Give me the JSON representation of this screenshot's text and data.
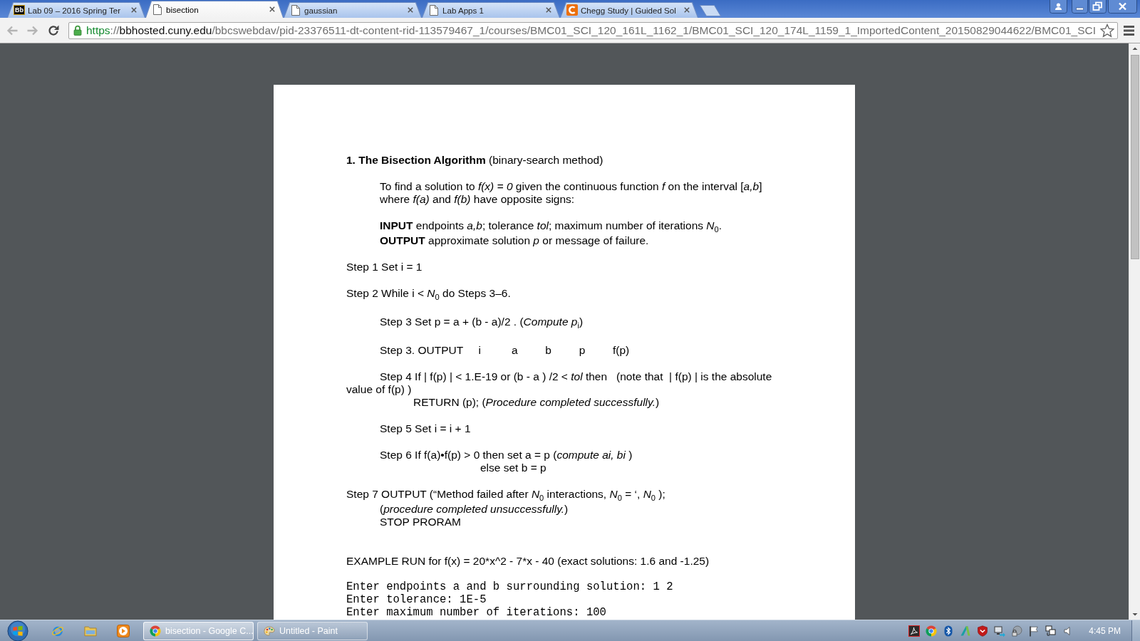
{
  "browser": {
    "tabs": [
      {
        "kind": "badge",
        "title": "Lab 09 – 2016 Spring Ter",
        "favicon_text": "Bb",
        "selected": false
      },
      {
        "kind": "page",
        "title": "bisection",
        "selected": true
      },
      {
        "kind": "page",
        "title": "gaussian",
        "selected": false
      },
      {
        "kind": "page",
        "title": "Lab Apps 1",
        "selected": false
      },
      {
        "kind": "letter-c",
        "title": "Chegg Study | Guided Sol",
        "selected": false
      }
    ],
    "nav": [
      {
        "kind": "back",
        "disabled": true
      },
      {
        "kind": "forward",
        "disabled": true
      },
      {
        "kind": "reload",
        "disabled": false
      }
    ],
    "address": [
      {
        "kind": "scheme",
        "text": "https"
      },
      {
        "kind": "separator",
        "text": "://"
      },
      {
        "kind": "host",
        "text": "bbhosted.cuny.edu"
      },
      {
        "kind": "path",
        "text": "/bbcswebdav/pid-23376511-dt-content-rid-113579467_1/courses/BMC01_SCI_120_161L_1162_1/BMC01_SCI_120_174L_1159_1_ImportedContent_20150829044622/BMC01_SCI"
      }
    ]
  },
  "document": {
    "blocks": [
      {
        "kind": "heading",
        "lines": [
          {
            "kind": "flush",
            "text": "**1. The Bisection Algorithm** (binary-search method)"
          }
        ]
      },
      {
        "kind": "text",
        "lines": [
          {
            "kind": "indent",
            "text": "To find a solution to *f(x) = 0* given the continuous function *f* on the interval [*a,b*]"
          },
          {
            "kind": "indent",
            "text": "where *f(a)* and *f(b)* have opposite signs:"
          }
        ]
      },
      {
        "kind": "text",
        "lines": [
          {
            "kind": "indent",
            "text": "**INPUT** endpoints *a,b*; tolerance *tol*; maximum number of iterations *N*$_{0}$."
          },
          {
            "kind": "indent",
            "text": "**OUTPUT** approximate solution *p* or message of failure."
          }
        ]
      },
      {
        "kind": "step",
        "lines": [
          {
            "kind": "flush",
            "text": "Step 1 Set i = 1"
          }
        ]
      },
      {
        "kind": "step",
        "lines": [
          {
            "kind": "flush",
            "text": "Step 2 While i < *N*$_{0}$ do Steps 3–6."
          }
        ]
      },
      {
        "kind": "step",
        "lines": [
          {
            "kind": "indent",
            "text": "Step 3 Set p = a + (b - a)/2 . (*Compute p*$_{i}$)"
          }
        ]
      },
      {
        "kind": "step",
        "lines": [
          {
            "kind": "indent",
            "text": "Step 3. OUTPUT     i          a         b         p         f(p)"
          }
        ]
      },
      {
        "kind": "step",
        "lines": [
          {
            "kind": "indent",
            "text": "Step 4 If | f(p) | < 1.E-19 or (b - a ) /2 < *tol* then   (note that  | f(p) | is the absolute"
          },
          {
            "kind": "flush",
            "text": "value of f(p) )"
          },
          {
            "kind": "deep",
            "text": "RETURN (p); (*Procedure completed successfully.*)"
          }
        ]
      },
      {
        "kind": "step",
        "lines": [
          {
            "kind": "indent",
            "text": "Step 5 Set i = i + 1"
          }
        ]
      },
      {
        "kind": "step",
        "lines": [
          {
            "kind": "indent",
            "text": "Step 6 If f(a)•f(p) > 0 then set a = p (*compute ai, bi* )"
          },
          {
            "kind": "far",
            "text": "else set b = p"
          }
        ]
      },
      {
        "kind": "step",
        "lines": [
          {
            "kind": "flush",
            "text": "Step 7 OUTPUT (“Method failed after *N*$_{0}$ interactions, *N*$_{0}$ = ‘, *N*$_{0}$ );"
          },
          {
            "kind": "indent",
            "text": "(*procedure completed unsuccessfully.*)"
          },
          {
            "kind": "indent",
            "text": "STOP PRORAM"
          }
        ]
      },
      {
        "kind": "plain",
        "lines": [
          {
            "kind": "flush",
            "text": "EXAMPLE RUN for f(x) = 20*x^2 - 7*x - 40 (exact solutions: 1.6 and -1.25)"
          }
        ]
      },
      {
        "kind": "code",
        "lines": [
          {
            "kind": "flush",
            "text": "Enter endpoints a and b surrounding solution: 1 2"
          },
          {
            "kind": "flush",
            "text": "Enter tolerance: 1E-5"
          },
          {
            "kind": "flush",
            "text": "Enter maximum number of iterations: 100"
          }
        ]
      }
    ]
  },
  "taskbar": {
    "tasks": [
      {
        "kind": "browser",
        "title": "bisection - Google C...",
        "selected": true
      },
      {
        "kind": "paint",
        "title": "Untitled - Paint",
        "selected": false
      }
    ],
    "clock": "4:45 PM"
  }
}
